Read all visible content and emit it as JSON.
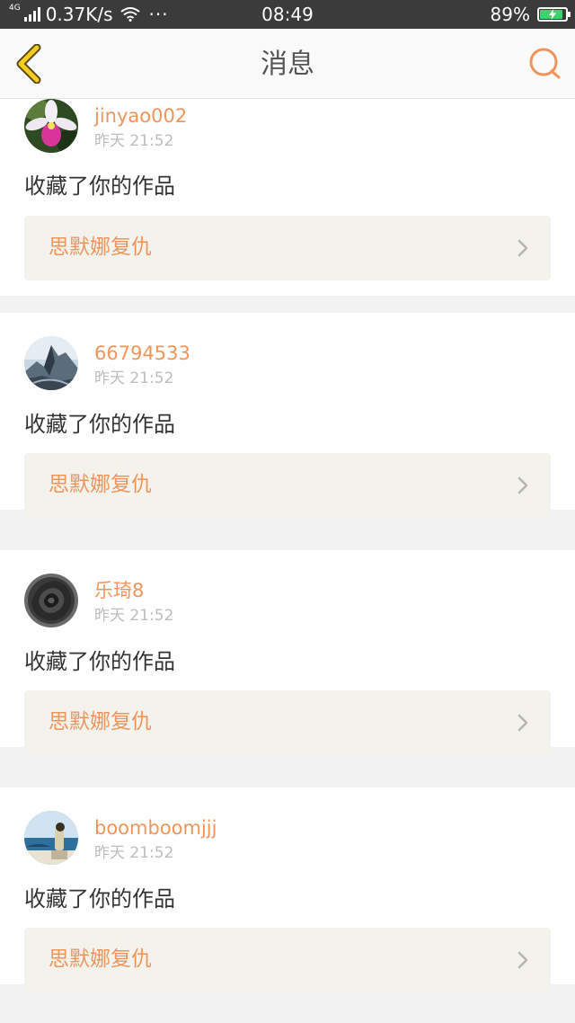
{
  "status_bar": {
    "network_type": "4G",
    "speed": "0.37K/s",
    "dots": "···",
    "time": "08:49",
    "battery": "89%",
    "battery_level": 0.89,
    "battery_color": "#3bd36b"
  },
  "nav": {
    "title": "消息",
    "back_icon": "chevron-left-icon",
    "search_icon": "search-icon",
    "accent_color": "#f0955a",
    "back_color": "#f5cc1f"
  },
  "messages": [
    {
      "username": "jinyao002",
      "time": "昨天 21:52",
      "action": "收藏了你的作品",
      "work_title": "思默娜复仇",
      "avatar": "orchid-avatar"
    },
    {
      "username": "66794533",
      "time": "昨天 21:52",
      "action": "收藏了你的作品",
      "work_title": "思默娜复仇",
      "avatar": "mountain-avatar"
    },
    {
      "username": "乐琦8",
      "time": "昨天 21:52",
      "action": "收藏了你的作品",
      "work_title": "思默娜复仇",
      "avatar": "rose-avatar"
    },
    {
      "username": "boomboomjjj",
      "time": "昨天 21:52",
      "action": "收藏了你的作品",
      "work_title": "思默娜复仇",
      "avatar": "seaside-avatar"
    }
  ]
}
